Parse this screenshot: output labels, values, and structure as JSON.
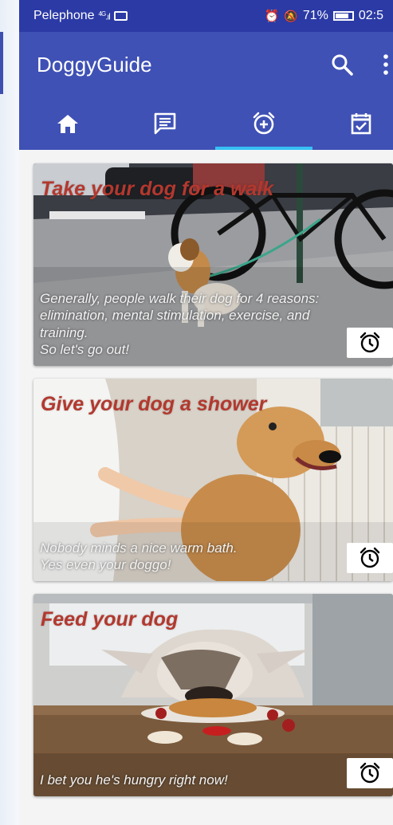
{
  "status": {
    "carrier": "Pelephone",
    "network": "4G",
    "battery": "71%",
    "time": "02:5"
  },
  "app": {
    "title": "DoggyGuide"
  },
  "tabs": [
    {
      "name": "home",
      "icon": "home-icon"
    },
    {
      "name": "messages",
      "icon": "chat-icon"
    },
    {
      "name": "alarm",
      "icon": "add-alarm-icon",
      "selected": true
    },
    {
      "name": "calendar",
      "icon": "calendar-check-icon"
    }
  ],
  "cards": [
    {
      "title": "Take your dog for a walk",
      "description": "Generally, people walk their dog for 4 reasons: elimination, mental stimulation, exercise, and training.\nSo let's go out!",
      "action_icon": "alarm-icon"
    },
    {
      "title": "Give your dog a shower",
      "description": "Nobody minds a nice warm bath.\nYes even your doggo!",
      "action_icon": "alarm-icon"
    },
    {
      "title": "Feed your dog",
      "description": "I bet you he's hungry right now!",
      "action_icon": "alarm-icon"
    }
  ],
  "colors": {
    "status_bar": "#2b3aa5",
    "primary": "#3f51b5",
    "indicator": "#36c0f5",
    "card_title": "#b3382e"
  }
}
